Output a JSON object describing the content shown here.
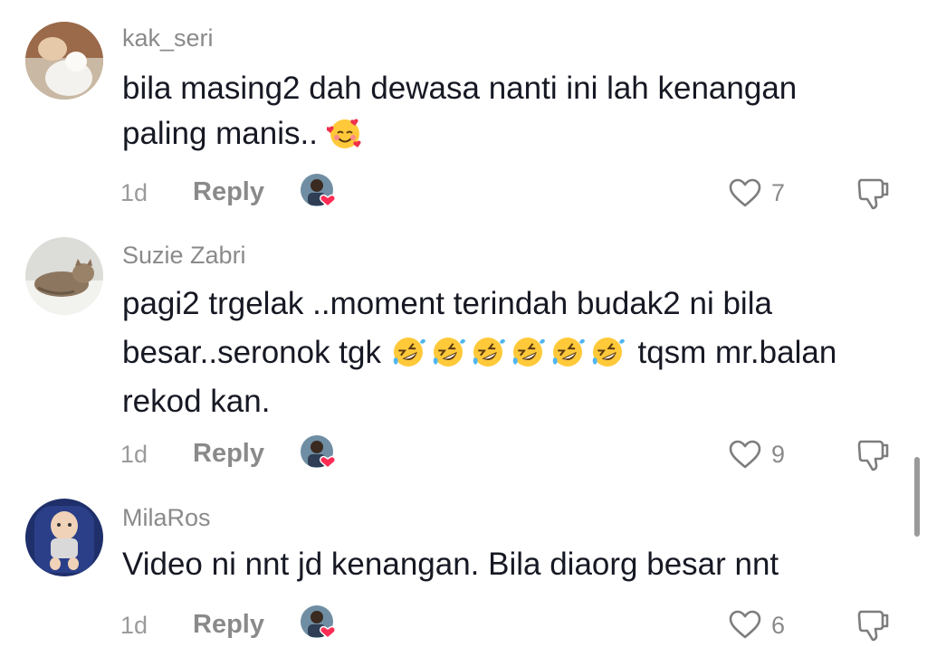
{
  "comments": [
    {
      "username": "kak_seri",
      "text": "bila masing2 dah dewasa nanti ini lah kenangan paling manis..",
      "emoji_after": [
        "smiling-face-with-hearts-emoji"
      ],
      "time": "1d",
      "reply_label": "Reply",
      "likes": "7"
    },
    {
      "username": "Suzie Zabri",
      "text_before": "pagi2 trgelak ..moment terindah budak2 ni bila besar..seronok tgk",
      "emoji_mid": [
        "rolling-laughing-emoji",
        "rolling-laughing-emoji",
        "rolling-laughing-emoji",
        "rolling-laughing-emoji",
        "rolling-laughing-emoji",
        "rolling-laughing-emoji"
      ],
      "text_after": "tqsm mr.balan rekod kan.",
      "time": "1d",
      "reply_label": "Reply",
      "likes": "9"
    },
    {
      "username": "MilaRos",
      "text": "Video ni nnt jd kenangan. Bila diaorg besar nnt",
      "time": "1d",
      "reply_label": "Reply",
      "likes": "6"
    }
  ],
  "colors": {
    "text": "#161823",
    "meta": "#8a8a8a",
    "liker_heart": "#fe2c55"
  }
}
